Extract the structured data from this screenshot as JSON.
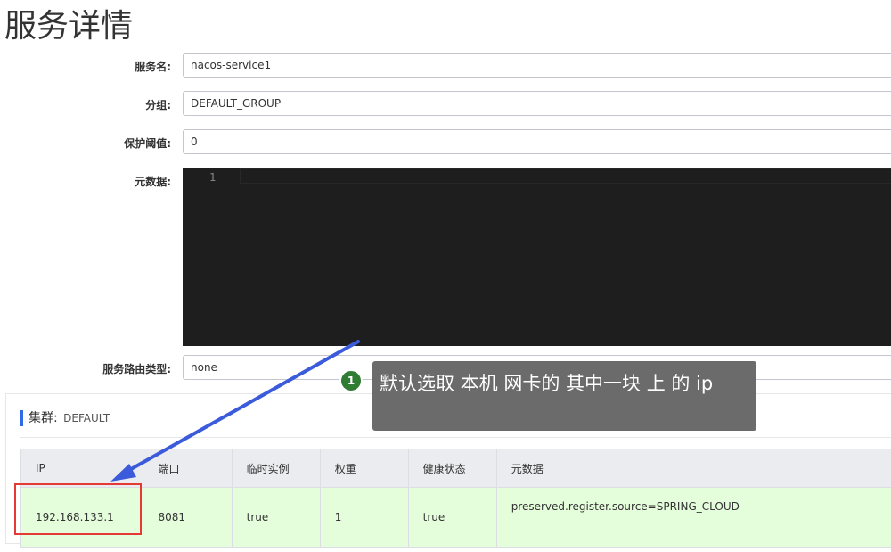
{
  "page": {
    "title": "服务详情"
  },
  "form": {
    "service_name": {
      "label": "服务名:",
      "value": "nacos-service1"
    },
    "group": {
      "label": "分组:",
      "value": "DEFAULT_GROUP"
    },
    "protect_threshold": {
      "label": "保护阈值:",
      "value": "0"
    },
    "metadata": {
      "label": "元数据:",
      "line_number": "1"
    },
    "route_type": {
      "label": "服务路由类型:",
      "value": "none"
    }
  },
  "cluster": {
    "label": "集群:",
    "name": "DEFAULT",
    "columns": [
      "IP",
      "端口",
      "临时实例",
      "权重",
      "健康状态",
      "元数据"
    ],
    "rows": [
      [
        "192.168.133.1",
        "8081",
        "true",
        "1",
        "true",
        "preserved.register.source=SPRING_CLOUD"
      ]
    ]
  },
  "annotation": {
    "step": "1",
    "text": "默认选取 本机 网卡的 其中一块 上 的 ip",
    "colors": {
      "badge": "#2e7d32",
      "callout_bg": "#6b6b6b",
      "arrow": "#3b5bdb",
      "highlight": "#e53935"
    }
  }
}
